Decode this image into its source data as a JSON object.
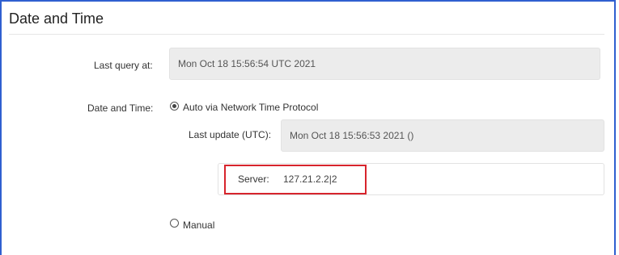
{
  "section": {
    "title": "Date and Time"
  },
  "last_query": {
    "label": "Last query at:",
    "value": "Mon Oct 18 15:56:54 UTC 2021"
  },
  "date_time": {
    "label": "Date and Time:",
    "selected_mode": "auto",
    "auto_option": {
      "label": "Auto via Network Time Protocol",
      "checked": true
    },
    "last_update": {
      "label": "Last update (UTC):",
      "value": "Mon Oct 18 15:56:53 2021 ()"
    },
    "server": {
      "label": "Server:",
      "value": "127.21.2.2|2"
    },
    "manual_option": {
      "label": "Manual",
      "checked": false
    }
  },
  "colors": {
    "frame_border": "#2f5fd0",
    "highlight_border": "#d7242c",
    "readonly_background": "#ececec"
  },
  "icons": {
    "auto_radio": "radio-selected-icon",
    "manual_radio": "radio-unselected-icon"
  }
}
